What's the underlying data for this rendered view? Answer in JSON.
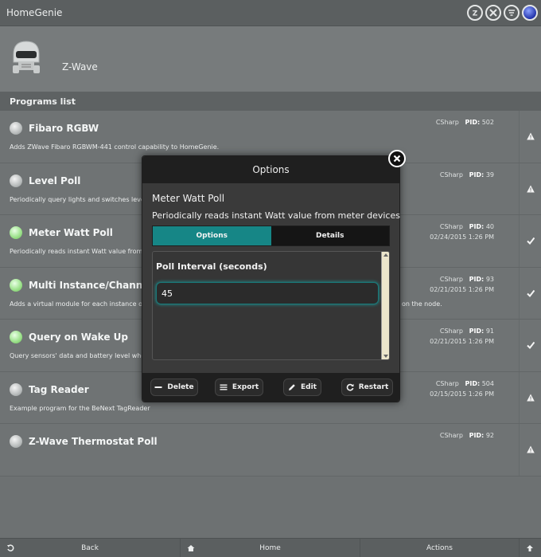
{
  "app": {
    "title": "HomeGenie"
  },
  "top_icons": [
    "zwave-icon",
    "x10-icon",
    "filter-icon",
    "blue-orb-icon"
  ],
  "header": {
    "module": "Z-Wave"
  },
  "section": {
    "title": "Programs list"
  },
  "programs": [
    {
      "name": "Fibaro RGBW",
      "desc": "Adds ZWave Fibaro RGBWM-441 control capability to HomeGenie.",
      "lang": "CSharp",
      "pid_label": "PID:",
      "pid": "502",
      "date": "",
      "led": "grey",
      "status_icon": "warning-icon"
    },
    {
      "name": "Level Poll",
      "desc": "Periodically query lights and switches leve",
      "lang": "CSharp",
      "pid_label": "PID:",
      "pid": "39",
      "date": "",
      "led": "grey",
      "status_icon": "warning-icon"
    },
    {
      "name": "Meter Watt Poll",
      "desc": "Periodically reads instant Watt value from r",
      "lang": "CSharp",
      "pid_label": "PID:",
      "pid": "40",
      "date": "02/24/2015 1:26 PM",
      "led": "green",
      "status_icon": "check-icon"
    },
    {
      "name": "Multi Instance/Channel Vi",
      "desc": "Adds a virtual module for each instance of",
      "desc_tail": "on the node.",
      "lang": "CSharp",
      "pid_label": "PID:",
      "pid": "93",
      "date": "02/21/2015 1:26 PM",
      "led": "green",
      "status_icon": "check-icon"
    },
    {
      "name": "Query on Wake Up",
      "desc": "Query sensors' data and battery level whe",
      "lang": "CSharp",
      "pid_label": "PID:",
      "pid": "91",
      "date": "02/21/2015 1:26 PM",
      "led": "green",
      "status_icon": "check-icon"
    },
    {
      "name": "Tag Reader",
      "desc": "Example program for the BeNext TagReader",
      "lang": "CSharp",
      "pid_label": "PID:",
      "pid": "504",
      "date": "02/15/2015 1:26 PM",
      "led": "grey",
      "status_icon": "warning-icon"
    },
    {
      "name": "Z-Wave Thermostat Poll",
      "desc": "",
      "lang": "CSharp",
      "pid_label": "PID:",
      "pid": "92",
      "date": "",
      "led": "grey",
      "status_icon": "warning-icon"
    }
  ],
  "bottom": {
    "back": "Back",
    "home": "Home",
    "actions": "Actions"
  },
  "modal": {
    "header": "Options",
    "title": "Meter Watt Poll",
    "desc": "Periodically reads instant Watt value from meter devices",
    "tabs": [
      "Options",
      "Details"
    ],
    "field_label": "Poll Interval (seconds)",
    "field_value": "45",
    "buttons": {
      "delete": "Delete",
      "export": "Export",
      "edit": "Edit",
      "restart": "Restart"
    },
    "accent": "#168686"
  }
}
